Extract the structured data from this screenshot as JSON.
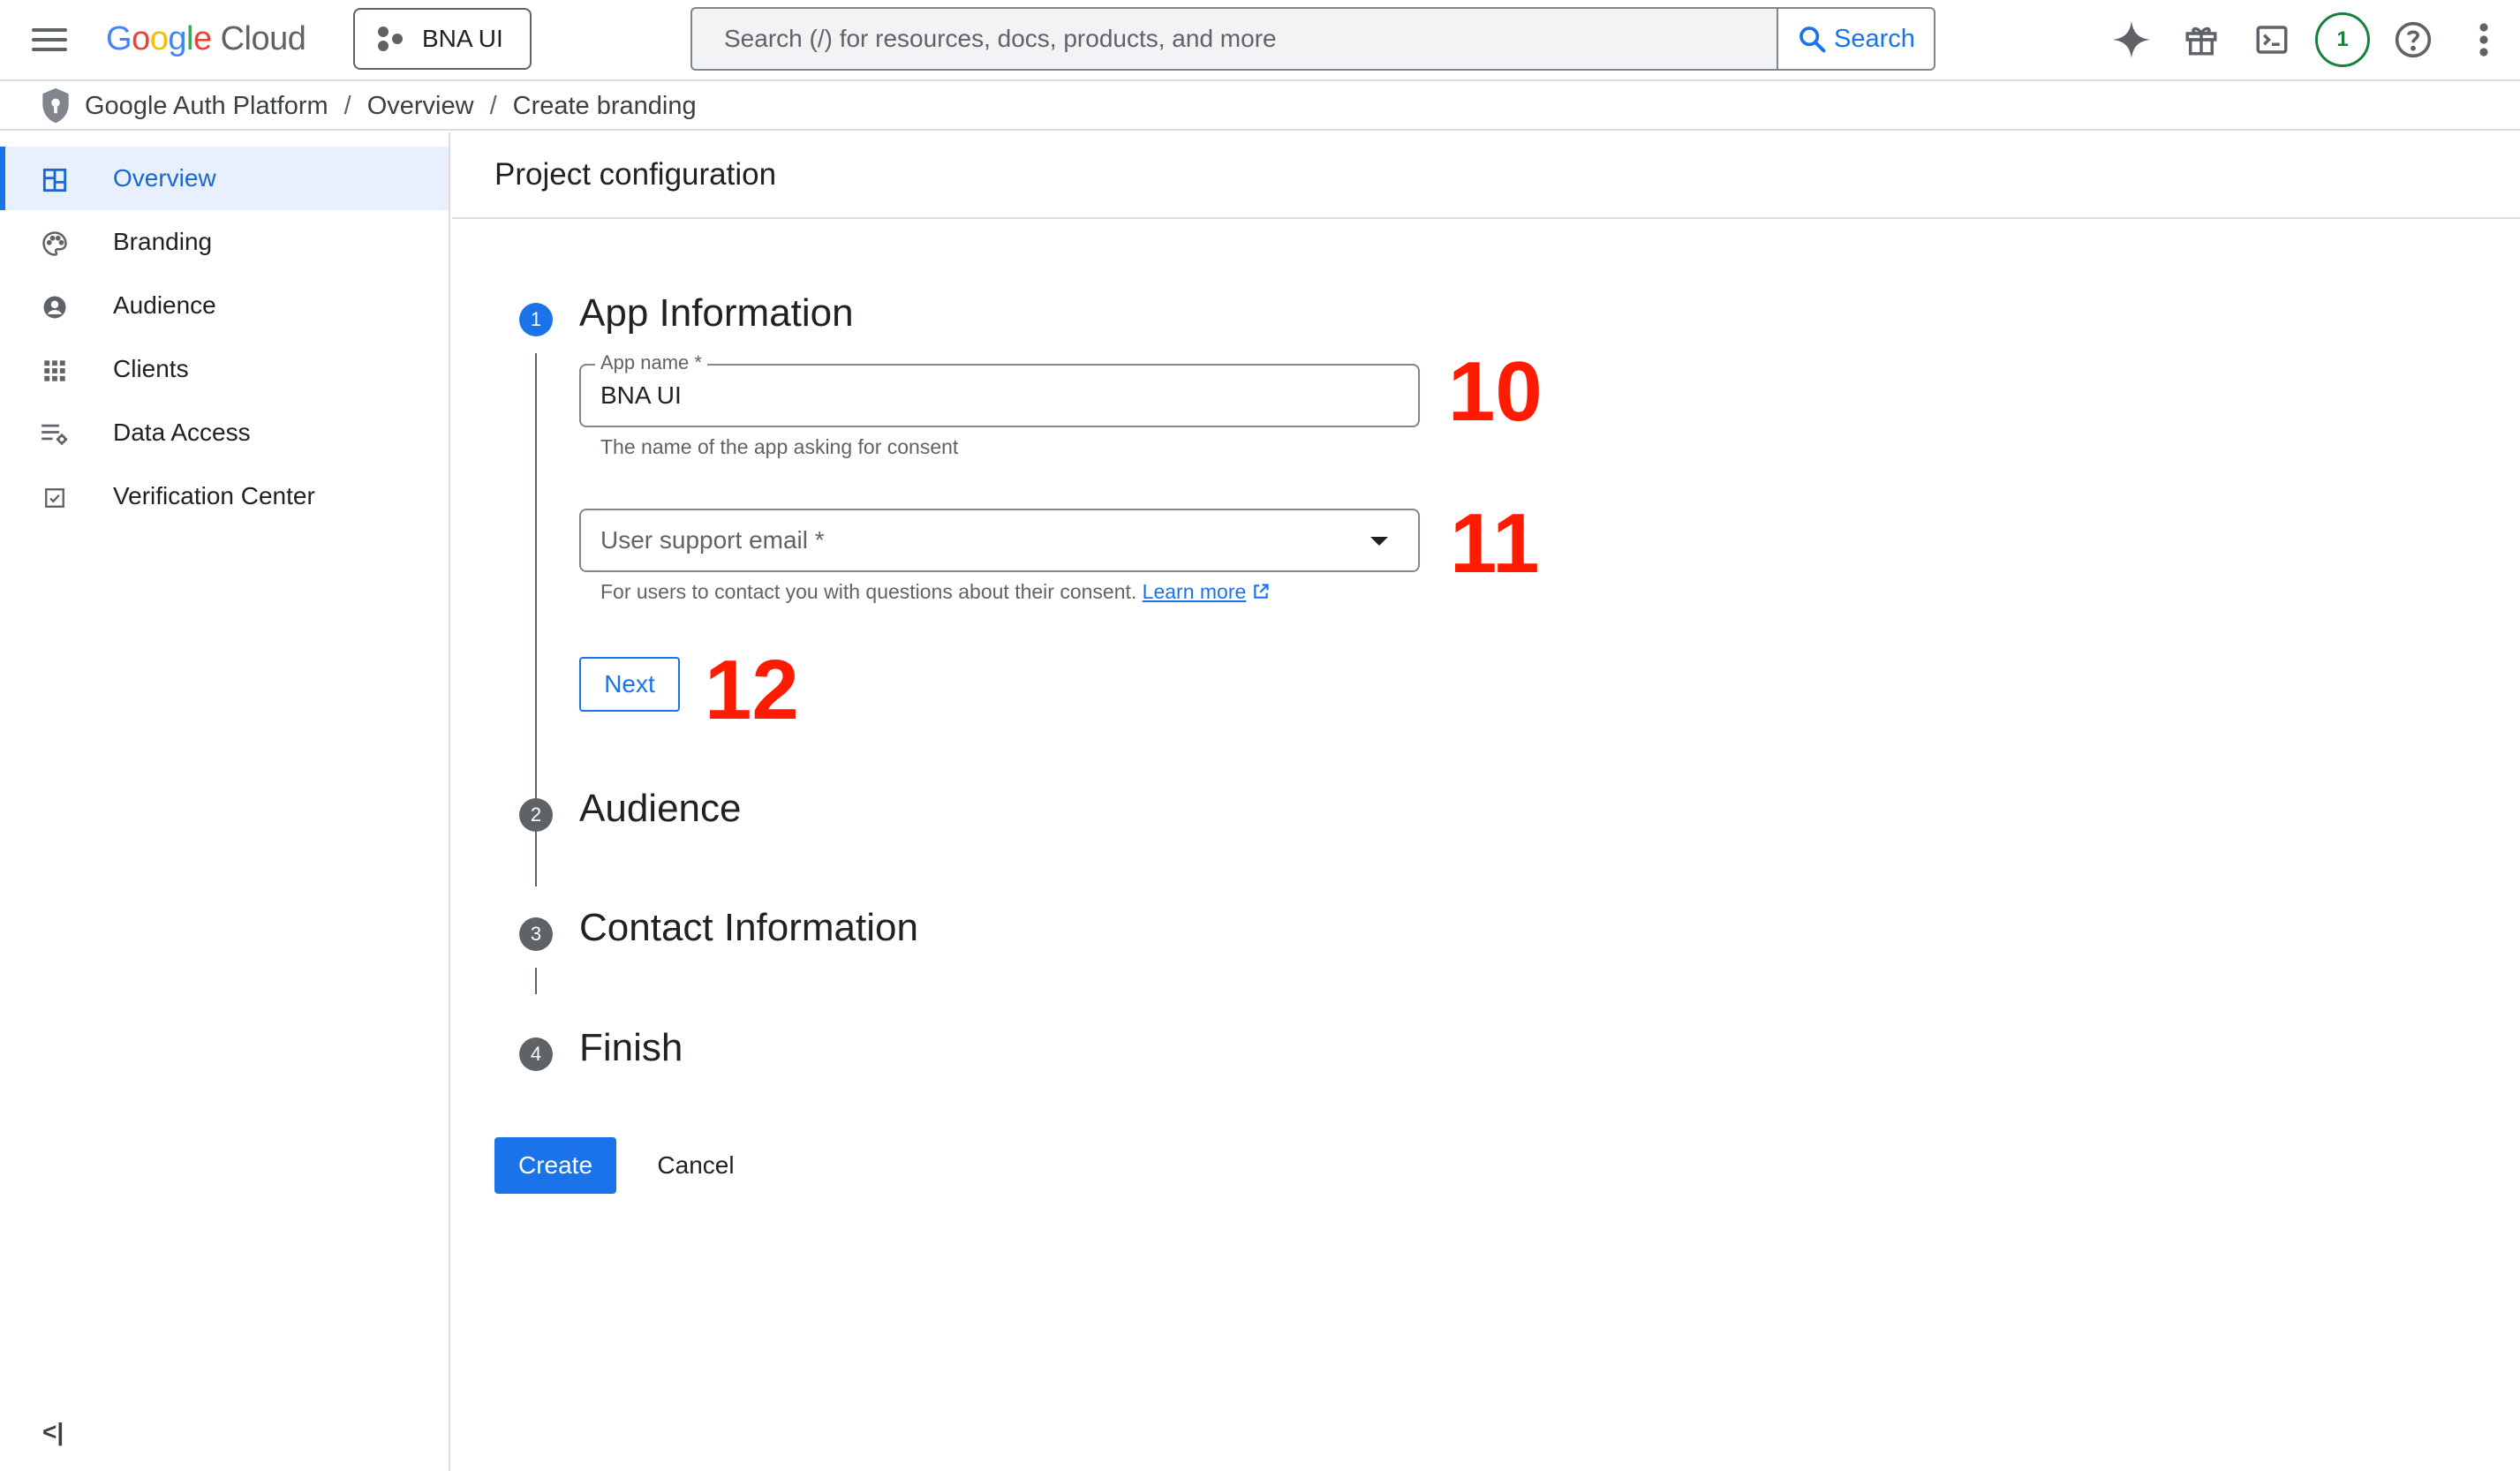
{
  "topbar": {
    "logo_word": "Google",
    "logo_product": "Cloud",
    "project_name": "BNA UI",
    "search_placeholder": "Search (/) for resources, docs, products, and more",
    "search_button": "Search",
    "notification_count": "1",
    "icons": [
      "menu-icon",
      "gemini-sparkle-icon",
      "gift-icon",
      "cloud-shell-icon",
      "help-icon",
      "more-vert-icon"
    ]
  },
  "breadcrumb": {
    "items": [
      "Google Auth Platform",
      "Overview",
      "Create branding"
    ],
    "separator": "/"
  },
  "sidebar": {
    "items": [
      {
        "label": "Overview",
        "icon": "dashboard-icon",
        "active": true
      },
      {
        "label": "Branding",
        "icon": "palette-icon",
        "active": false
      },
      {
        "label": "Audience",
        "icon": "account-circle-icon",
        "active": false
      },
      {
        "label": "Clients",
        "icon": "apps-grid-icon",
        "active": false
      },
      {
        "label": "Data Access",
        "icon": "list-settings-icon",
        "active": false
      },
      {
        "label": "Verification Center",
        "icon": "checkbox-icon",
        "active": false
      }
    ],
    "collapse_label": "<|"
  },
  "main": {
    "title": "Project configuration",
    "steps": [
      {
        "number": "1",
        "title": "App Information"
      },
      {
        "number": "2",
        "title": "Audience"
      },
      {
        "number": "3",
        "title": "Contact Information"
      },
      {
        "number": "4",
        "title": "Finish"
      }
    ],
    "app_name": {
      "label": "App name *",
      "value": "BNA UI",
      "hint": "The name of the app asking for consent"
    },
    "support_email": {
      "placeholder": "User support email *",
      "hint": "For users to contact you with questions about their consent.",
      "link": "Learn more"
    },
    "next_button": "Next",
    "create_button": "Create",
    "cancel_button": "Cancel"
  },
  "annotations": [
    "10",
    "11",
    "12"
  ],
  "colors": {
    "accent": "#1a73e8",
    "annotation": "#ff1a00",
    "notification": "#188038"
  }
}
